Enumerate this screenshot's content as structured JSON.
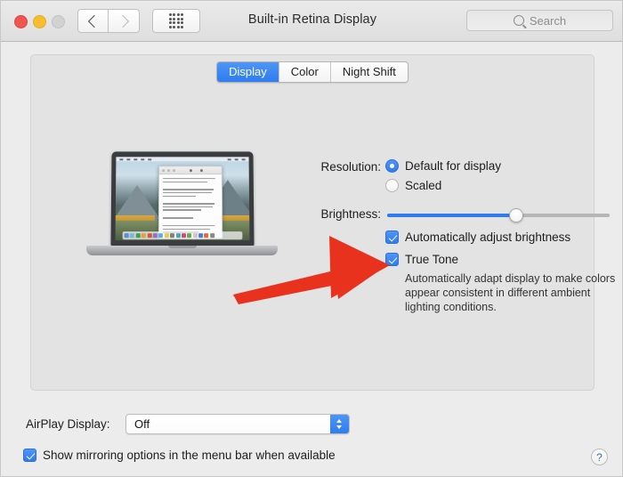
{
  "window": {
    "title": "Built-in Retina Display",
    "traffic_lights": [
      "close",
      "minimize",
      "zoom"
    ],
    "nav": {
      "back": "back-chevron",
      "forward": "forward-chevron",
      "show_all": "grid-icon"
    }
  },
  "search": {
    "placeholder": "Search",
    "icon": "search-icon",
    "value": ""
  },
  "tabs": [
    {
      "label": "Display",
      "active": true
    },
    {
      "label": "Color",
      "active": false
    },
    {
      "label": "Night Shift",
      "active": false
    }
  ],
  "preview": {
    "device": "macbook-pro-illustration",
    "wallpaper": "macos-high-sierra"
  },
  "display_settings": {
    "resolution_label": "Resolution:",
    "resolution_options": [
      {
        "label": "Default for display",
        "selected": true
      },
      {
        "label": "Scaled",
        "selected": false
      }
    ],
    "brightness_label": "Brightness:",
    "brightness_value": 58,
    "checkboxes": [
      {
        "label": "Automatically adjust brightness",
        "checked": true
      },
      {
        "label": "True Tone",
        "checked": true
      }
    ],
    "true_tone_description": "Automatically adapt display to make colors appear consistent in different ambient lighting conditions."
  },
  "annotation": {
    "type": "arrow",
    "color": "#e8321e",
    "points_to": "true-tone-checkbox"
  },
  "footer": {
    "airplay_label": "AirPlay Display:",
    "airplay_value": "Off",
    "mirroring_label": "Show mirroring options in the menu bar when available",
    "mirroring_checked": true,
    "help_label": "?"
  },
  "colors": {
    "accent": "#2f7cf0",
    "window_bg": "#ececec",
    "panel_bg": "#e3e3e3",
    "annotation_red": "#e8321e"
  }
}
